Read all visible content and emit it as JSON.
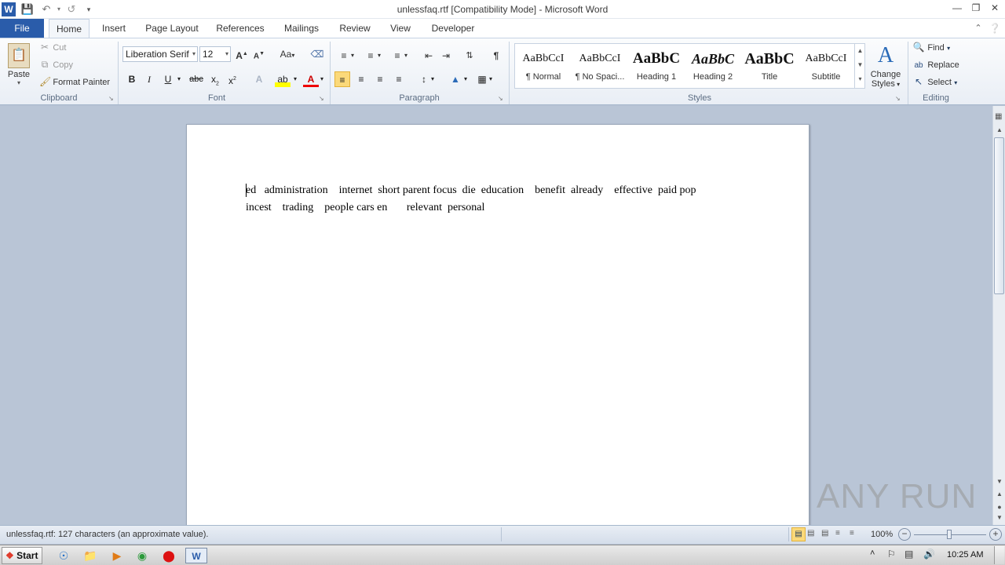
{
  "window": {
    "title": "unlessfaq.rtf [Compatibility Mode] - Microsoft Word"
  },
  "tabs": [
    "File",
    "Home",
    "Insert",
    "Page Layout",
    "References",
    "Mailings",
    "Review",
    "View",
    "Developer"
  ],
  "clipboard": {
    "group": "Clipboard",
    "paste": "Paste",
    "cut": "Cut",
    "copy": "Copy",
    "format_painter": "Format Painter"
  },
  "font": {
    "group": "Font",
    "family": "Liberation Serif",
    "size": "12"
  },
  "paragraph": {
    "group": "Paragraph"
  },
  "styles": {
    "group": "Styles",
    "items": [
      {
        "preview": "AaBbCcI",
        "name": "¶ Normal"
      },
      {
        "preview": "AaBbCcI",
        "name": "¶ No Spaci..."
      },
      {
        "preview": "AaBbC",
        "name": "Heading 1"
      },
      {
        "preview": "AaBbC",
        "name": "Heading 2"
      },
      {
        "preview": "AaBbC",
        "name": "Title"
      },
      {
        "preview": "AaBbCcI",
        "name": "Subtitle"
      }
    ],
    "change_styles_1": "Change",
    "change_styles_2": "Styles"
  },
  "editing": {
    "group": "Editing",
    "find": "Find",
    "replace": "Replace",
    "select": "Select"
  },
  "document": {
    "line1": "ed   administration    internet  short parent focus  die  education    benefit  already    effective  paid pop",
    "line2": "incest    trading    people cars en       relevant  personal"
  },
  "status": {
    "text": "unlessfaq.rtf: 127 characters (an approximate value).",
    "zoom": "100%"
  },
  "taskbar": {
    "start": "Start",
    "time": "10:25 AM"
  },
  "watermark": "ANY RUN"
}
